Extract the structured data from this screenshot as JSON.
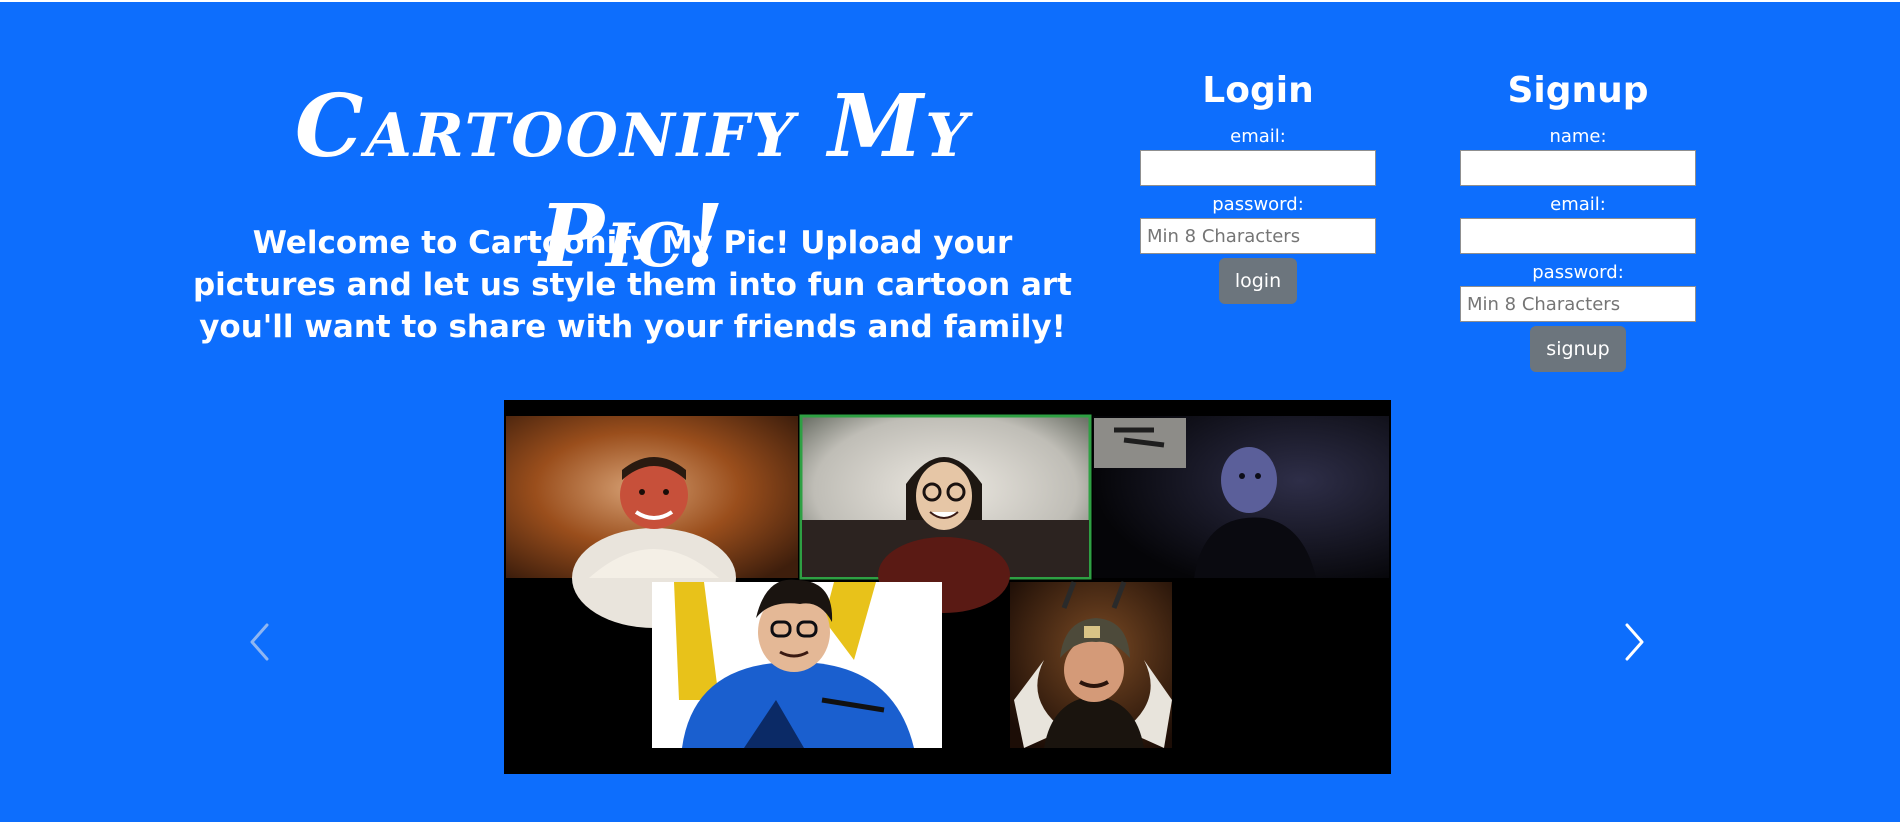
{
  "hero": {
    "title": "Cartoonify My Pic!",
    "welcome_text": "Welcome to Cartoonify My Pic! Upload your pictures and let us style them into fun cartoon art you'll want to share with your friends and family!"
  },
  "login": {
    "title": "Login",
    "email_label": "email:",
    "email_value": "",
    "password_label": "password:",
    "password_placeholder": "Min 8 Characters",
    "button_label": "login"
  },
  "signup": {
    "title": "Signup",
    "name_label": "name:",
    "name_value": "",
    "email_label": "email:",
    "email_value": "",
    "password_label": "password:",
    "password_placeholder": "Min 8 Characters",
    "button_label": "signup"
  },
  "carousel": {
    "prev_icon": "chevron-left-icon",
    "next_icon": "chevron-right-icon",
    "slide_description": "cartoonified video call screenshot with five participants"
  },
  "colors": {
    "background": "#0d6efd",
    "button": "#6c757d",
    "text": "#ffffff"
  }
}
